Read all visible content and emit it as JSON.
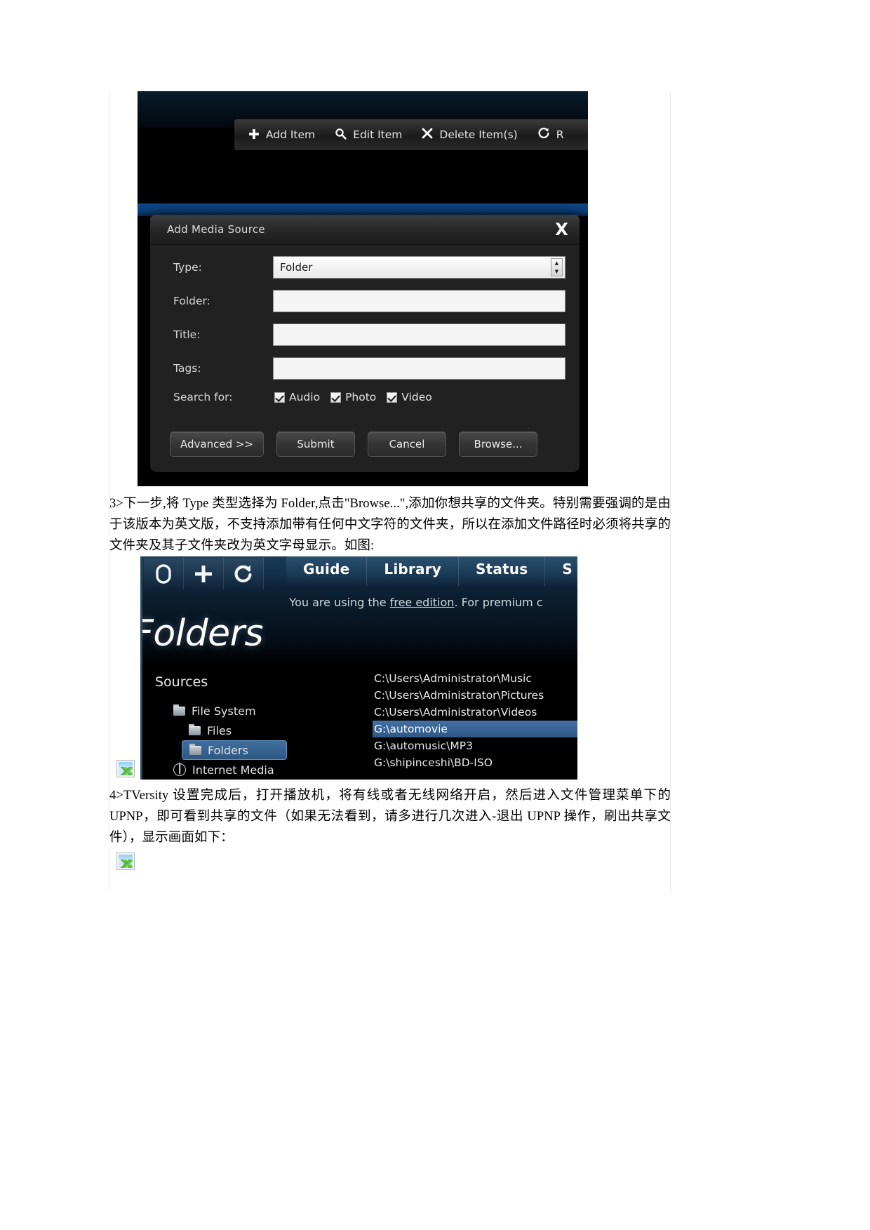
{
  "screenshot1": {
    "toolbar": {
      "items": [
        {
          "icon": "plus-icon",
          "glyph": "✚",
          "label": "Add Item"
        },
        {
          "icon": "magnifier-icon",
          "glyph": "🔍",
          "label": "Edit Item"
        },
        {
          "icon": "cross-icon",
          "glyph": "✖",
          "label": "Delete Item(s)"
        },
        {
          "icon": "refresh-icon",
          "glyph": "↻",
          "label": "R"
        }
      ]
    },
    "dialog": {
      "title": "Add Media Source",
      "close_label": "X",
      "fields": [
        {
          "label": "Type:",
          "value": "Folder",
          "kind": "select"
        },
        {
          "label": "Folder:",
          "value": "",
          "kind": "text"
        },
        {
          "label": "Title:",
          "value": "",
          "kind": "text"
        },
        {
          "label": "Tags:",
          "value": "",
          "kind": "text"
        }
      ],
      "search_for_label": "Search for:",
      "search_for_options": [
        {
          "label": "Audio",
          "checked": true
        },
        {
          "label": "Photo",
          "checked": true
        },
        {
          "label": "Video",
          "checked": true
        }
      ],
      "buttons": [
        {
          "label": "Advanced >>"
        },
        {
          "label": "Submit"
        },
        {
          "label": "Cancel"
        },
        {
          "label": "Browse..."
        }
      ]
    }
  },
  "paragraph1": "3>下一步,将 Type 类型选择为 Folder,点击\"Browse...\",添加你想共享的文件夹。特别需要强调的是由于该版本为英文版，不支持添加带有任何中文字符的文件夹，所以在添加文件路径时必须将共享的文件夹及其子文件夹改为英文字母显示。如图:",
  "screenshot2": {
    "icon_buttons": [
      {
        "name": "power-icon",
        "glyph": "⬜"
      },
      {
        "name": "plus-icon",
        "glyph": "＋"
      },
      {
        "name": "refresh-icon",
        "glyph": "↻"
      }
    ],
    "tabs": [
      {
        "label": "Guide"
      },
      {
        "label": "Library"
      },
      {
        "label": "Status"
      },
      {
        "label": "S"
      }
    ],
    "notice_prefix": "You are using the ",
    "notice_link": "free edition",
    "notice_suffix": ". For premium c",
    "heading": "Folders",
    "sources_label": "Sources",
    "tree": [
      {
        "label": "File System",
        "level": 1,
        "icon": "folder-icon",
        "selected": false
      },
      {
        "label": "Files",
        "level": 2,
        "icon": "folder-icon",
        "selected": false
      },
      {
        "label": "Folders",
        "level": 2,
        "icon": "folder-icon",
        "selected": true
      },
      {
        "label": "Internet Media",
        "level": 1,
        "icon": "globe-icon",
        "selected": false
      }
    ],
    "paths": [
      {
        "value": "C:\\Users\\Administrator\\Music",
        "selected": false
      },
      {
        "value": "C:\\Users\\Administrator\\Pictures",
        "selected": false
      },
      {
        "value": "C:\\Users\\Administrator\\Videos",
        "selected": false
      },
      {
        "value": "G:\\automovie",
        "selected": true
      },
      {
        "value": "G:\\automusic\\MP3",
        "selected": false
      },
      {
        "value": "G:\\shipinceshi\\BD-ISO",
        "selected": false
      }
    ]
  },
  "paragraph2": "4>TVersity 设置完成后，打开播放机，将有线或者无线网络开启，然后进入文件管理菜单下的 UPNP，即可看到共享的文件（如果无法看到，请多进行几次进入-退出 UPNP 操作，刷出共享文件），显示画面如下："
}
